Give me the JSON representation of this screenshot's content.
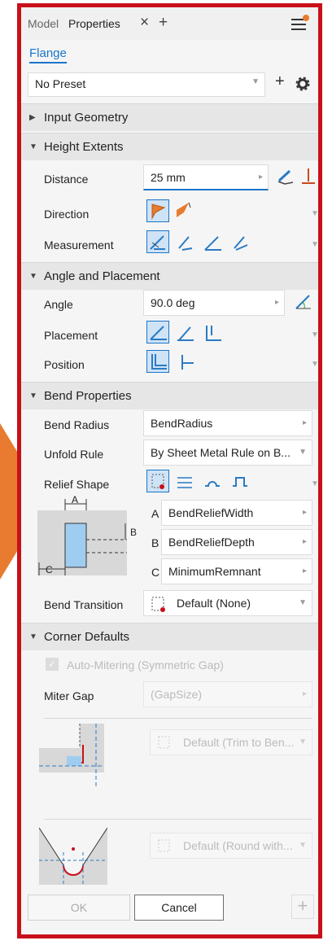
{
  "tabs": {
    "model": "Model",
    "properties": "Properties",
    "close": "×",
    "add": "+"
  },
  "feature_name": "Flange",
  "preset": {
    "value": "No Preset",
    "add": "+"
  },
  "sections": {
    "input_geometry": "Input Geometry",
    "height_extents": "Height Extents",
    "angle_placement": "Angle and Placement",
    "bend_properties": "Bend Properties",
    "corner_defaults": "Corner Defaults"
  },
  "height": {
    "distance_label": "Distance",
    "distance_value": "25 mm",
    "direction_label": "Direction",
    "measurement_label": "Measurement"
  },
  "angle": {
    "angle_label": "Angle",
    "angle_value": "90.0 deg",
    "placement_label": "Placement",
    "position_label": "Position"
  },
  "bend": {
    "radius_label": "Bend Radius",
    "radius_value": "BendRadius",
    "unfold_label": "Unfold Rule",
    "unfold_value": "By Sheet Metal Rule on B...",
    "relief_label": "Relief Shape",
    "a_letter": "A",
    "a_value": "BendReliefWidth",
    "b_letter": "B",
    "b_value": "BendReliefDepth",
    "c_letter": "C",
    "c_value": "MinimumRemnant",
    "diag_a": "A",
    "diag_b": "B",
    "diag_c": "C",
    "transition_label": "Bend Transition",
    "transition_value": "Default (None)"
  },
  "corner": {
    "auto_mitering": "Auto-Mitering (Symmetric Gap)",
    "miter_gap_label": "Miter Gap",
    "miter_gap_value": "(GapSize)",
    "trim_value": "Default (Trim to Ben...",
    "round_value": "Default (Round with..."
  },
  "footer": {
    "ok": "OK",
    "cancel": "Cancel",
    "plus": "+"
  },
  "colors": {
    "accent": "#1a75c9",
    "highlight": "#c8101a",
    "callout": "#e87b2f",
    "relief_fill": "#9fcdf0"
  }
}
